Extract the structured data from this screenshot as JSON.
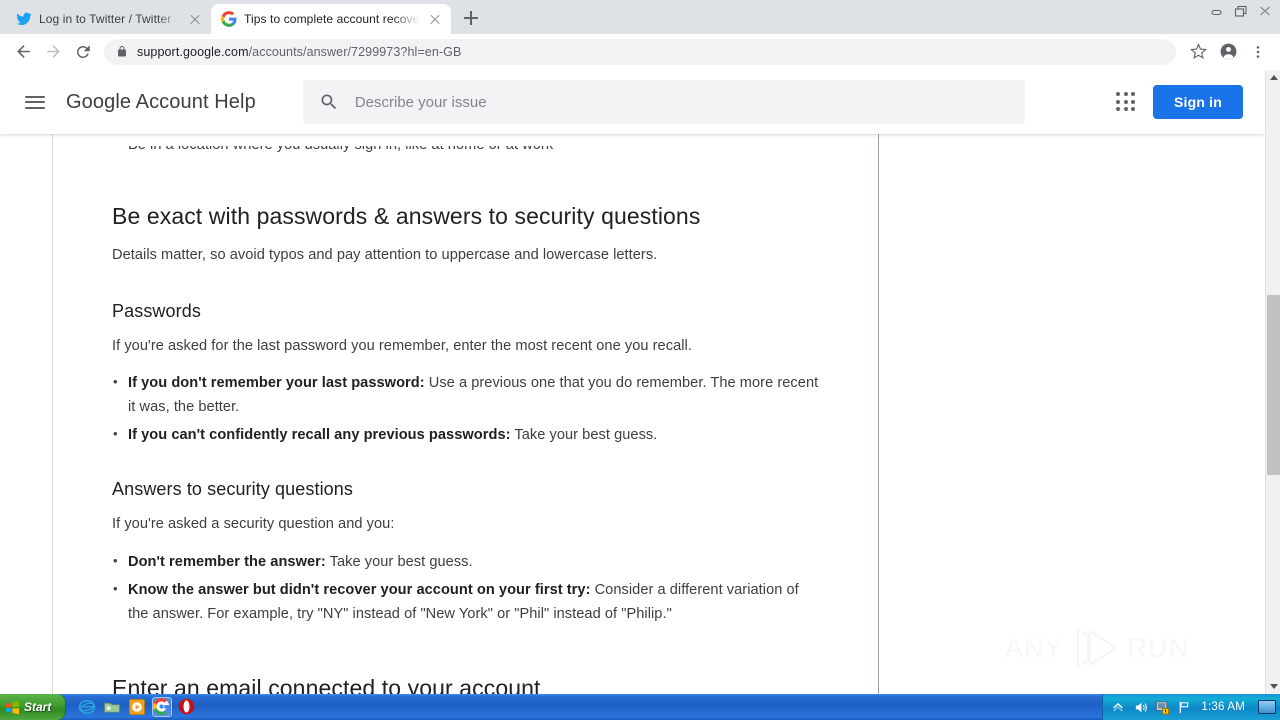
{
  "browser": {
    "tabs": [
      {
        "title": "Log in to Twitter / Twitter",
        "favicon": "twitter-icon",
        "active": false
      },
      {
        "title": "Tips to complete account recovery s",
        "favicon": "google-icon",
        "active": true
      }
    ],
    "new_tab_label": "+",
    "window_controls": [
      "minimize",
      "restore",
      "close"
    ],
    "nav": {
      "back": "back-arrow-icon",
      "forward": "forward-arrow-icon",
      "reload": "reload-icon"
    },
    "omnibox": {
      "lock_icon": "lock-icon",
      "url_domain": "support.google.com",
      "url_path": "/accounts/answer/7299973?hl=en-GB",
      "full_url": "support.google.com/accounts/answer/7299973?hl=en-GB"
    },
    "toolbar_icons": [
      "bookmark-star-icon",
      "profile-avatar-icon",
      "chrome-menu-icon"
    ]
  },
  "gs_header": {
    "menu_icon": "hamburger-menu-icon",
    "title": "Google Account Help",
    "search": {
      "icon": "search-icon",
      "placeholder": "Describe your issue",
      "value": ""
    },
    "apps_icon": "apps-grid-icon",
    "signin_label": "Sign in"
  },
  "article": {
    "clipped_bullet": "Be in a location where you usually sign in, like at home or at work",
    "section1": {
      "heading": "Be exact with passwords & answers to security questions",
      "intro": "Details matter, so avoid typos and pay attention to uppercase and lowercase letters.",
      "sub1": {
        "heading": "Passwords",
        "intro": "If you're asked for the last password you remember, enter the most recent one you recall.",
        "bullets": [
          {
            "bold": "If you don't remember your last password:",
            "rest": " Use a previous one that you do remember. The more recent it was, the better."
          },
          {
            "bold": "If you can't confidently recall any previous passwords:",
            "rest": " Take your best guess."
          }
        ]
      },
      "sub2": {
        "heading": "Answers to security questions",
        "intro": "If you're asked a security question and you:",
        "bullets": [
          {
            "bold": "Don't remember the answer:",
            "rest": " Take your best guess."
          },
          {
            "bold": "Know the answer but didn't recover your account on your first try:",
            "rest": " Consider a different variation of the answer. For example, try \"NY\" instead of \"New York\" or \"Phil\" instead of \"Philip.\""
          }
        ]
      }
    },
    "section2": {
      "heading": "Enter an email connected to your account"
    }
  },
  "watermark": {
    "left": "ANY",
    "right": "RUN",
    "logo": "play-triangle-logo"
  },
  "scrollbar": {
    "up_arrow": "scroll-up-arrow",
    "down_arrow": "scroll-down-arrow"
  },
  "taskbar": {
    "start_label": "Start",
    "start_icon": "windows-flag-icon",
    "quicklaunch": [
      {
        "name": "internet-explorer-icon"
      },
      {
        "name": "file-explorer-icon"
      },
      {
        "name": "media-player-icon"
      },
      {
        "name": "google-chrome-icon"
      },
      {
        "name": "opera-icon"
      }
    ],
    "tray_icons": [
      "show-hidden-icons",
      "volume-icon",
      "security-alert-icon",
      "network-flag-icon"
    ],
    "time": "1:36 AM",
    "show_desktop": "show-desktop-icon"
  },
  "colors": {
    "accent_blue": "#1a73e8",
    "tabstrip_bg": "#dee1e6",
    "search_bg": "#f1f3f4",
    "text_primary": "#202124",
    "text_secondary": "#3c4043",
    "taskbar_blue": "#1e5fc4"
  }
}
